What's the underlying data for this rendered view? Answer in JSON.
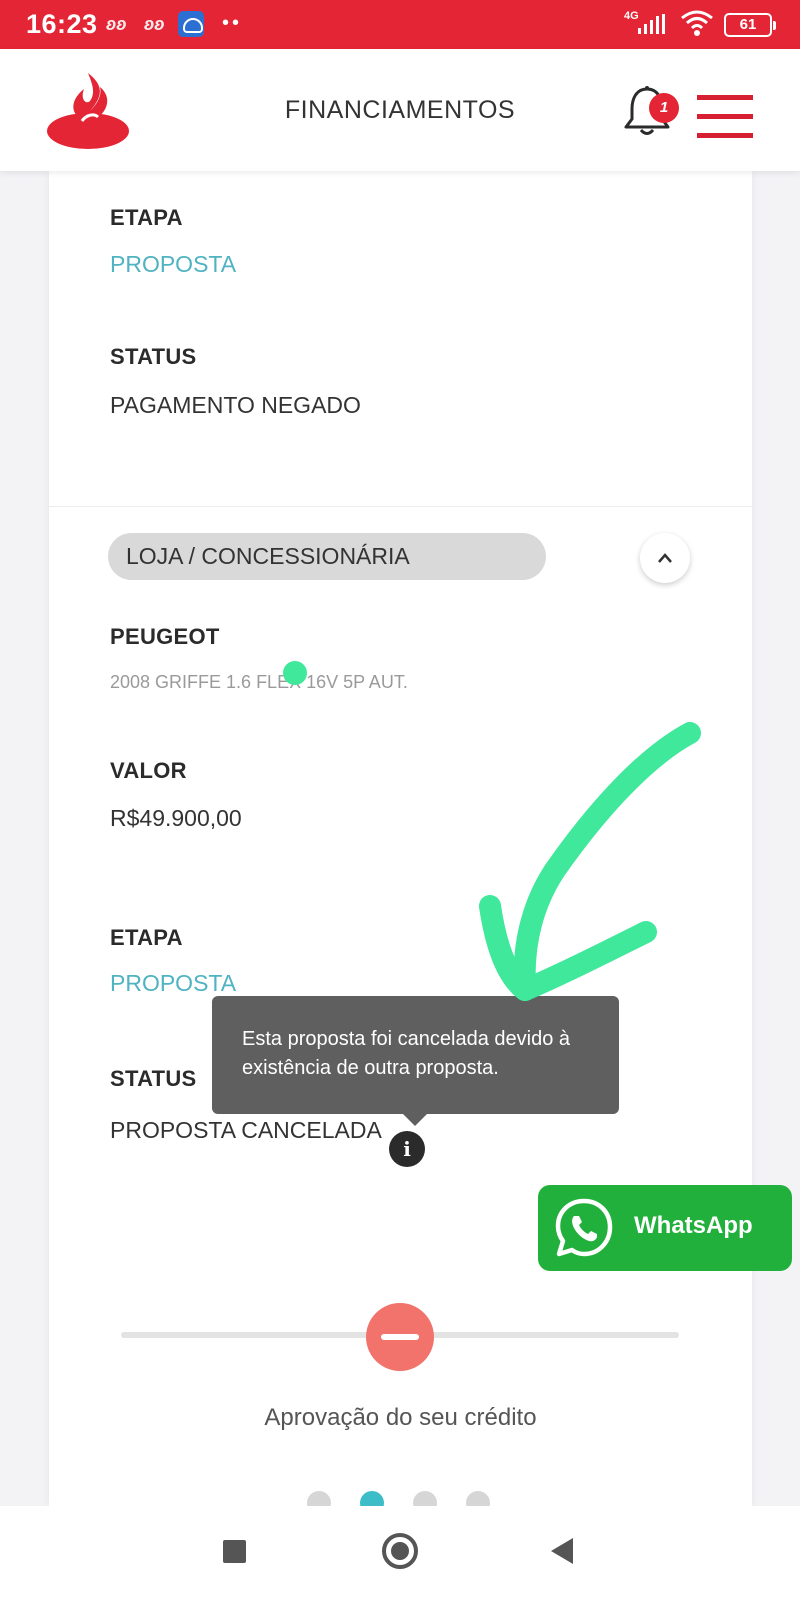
{
  "status_bar": {
    "time": "16:23",
    "network": "4G",
    "battery": "61",
    "dots": "••"
  },
  "header": {
    "title": "FINANCIAMENTOS",
    "notification_count": "1",
    "brand_color": "#e42535"
  },
  "card": {
    "top_section": {
      "etapa_label": "ETAPA",
      "etapa_value": "PROPOSTA",
      "status_label": "STATUS",
      "status_value": "PAGAMENTO NEGADO"
    },
    "store_pill": "LOJA / CONCESSIONÁRIA",
    "collapse_icon": "^",
    "vehicle": {
      "brand": "PEUGEOT",
      "model": "2008 GRIFFE 1.6 FLEX 16V 5P AUT."
    },
    "valor_label": "VALOR",
    "valor_value": "R$49.900,00",
    "etapa_label": "ETAPA",
    "etapa_value": "PROPOSTA",
    "status_label": "STATUS",
    "status_value": "PROPOSTA CANCELADA",
    "info_icon": "i",
    "tooltip": "Esta proposta foi cancelada devido à existência de outra proposta.",
    "progress_caption": "Aprovação do seu crédito",
    "pagination": {
      "total": 4,
      "active": 2
    }
  },
  "whatsapp": {
    "label": "WhatsApp",
    "color": "#22b03c"
  },
  "colors": {
    "teal": "#4fb3c1",
    "annotation": "#3fe89a",
    "status_dot": "#f2726c"
  }
}
